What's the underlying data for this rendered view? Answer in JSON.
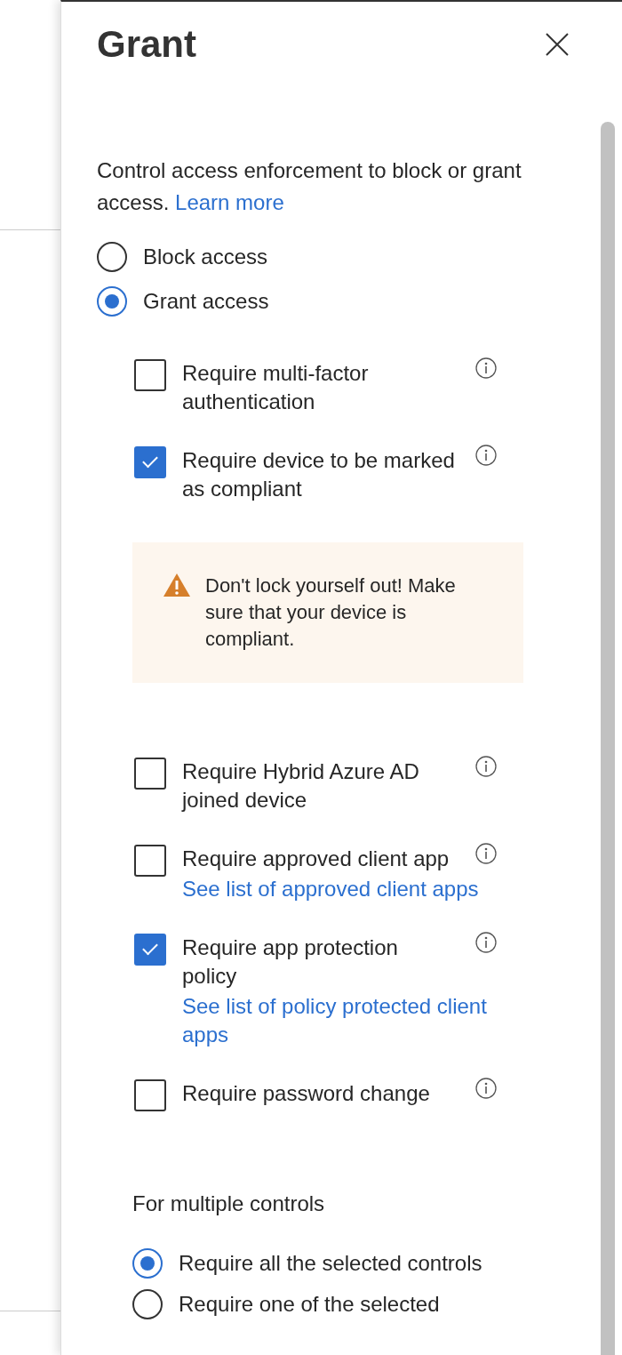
{
  "panel": {
    "title": "Grant",
    "intro": "Control access enforcement to block or grant access.",
    "intro_link": "Learn more"
  },
  "access_options": [
    {
      "label": "Block access",
      "selected": false
    },
    {
      "label": "Grant access",
      "selected": true
    }
  ],
  "controls": [
    {
      "kind": "checkbox",
      "label": "Require multi-factor authentication",
      "checked": false
    },
    {
      "kind": "checkbox",
      "label": "Require device to be marked as compliant",
      "checked": true
    },
    {
      "kind": "warning",
      "text": "Don't lock yourself out! Make sure that your device is compliant."
    },
    {
      "kind": "checkbox",
      "label": "Require Hybrid Azure AD joined device",
      "checked": false
    },
    {
      "kind": "checkbox",
      "label": "Require approved client app",
      "checked": false,
      "link": "See list of approved client apps"
    },
    {
      "kind": "checkbox",
      "label": "Require app protection policy",
      "checked": true,
      "link": "See list of policy protected client apps"
    },
    {
      "kind": "checkbox",
      "label": "Require password change",
      "checked": false
    }
  ],
  "multiple_controls": {
    "heading": "For multiple controls",
    "options": [
      {
        "label": "Require all the selected controls",
        "selected": true
      },
      {
        "label": "Require one of the selected",
        "selected": false
      }
    ]
  }
}
